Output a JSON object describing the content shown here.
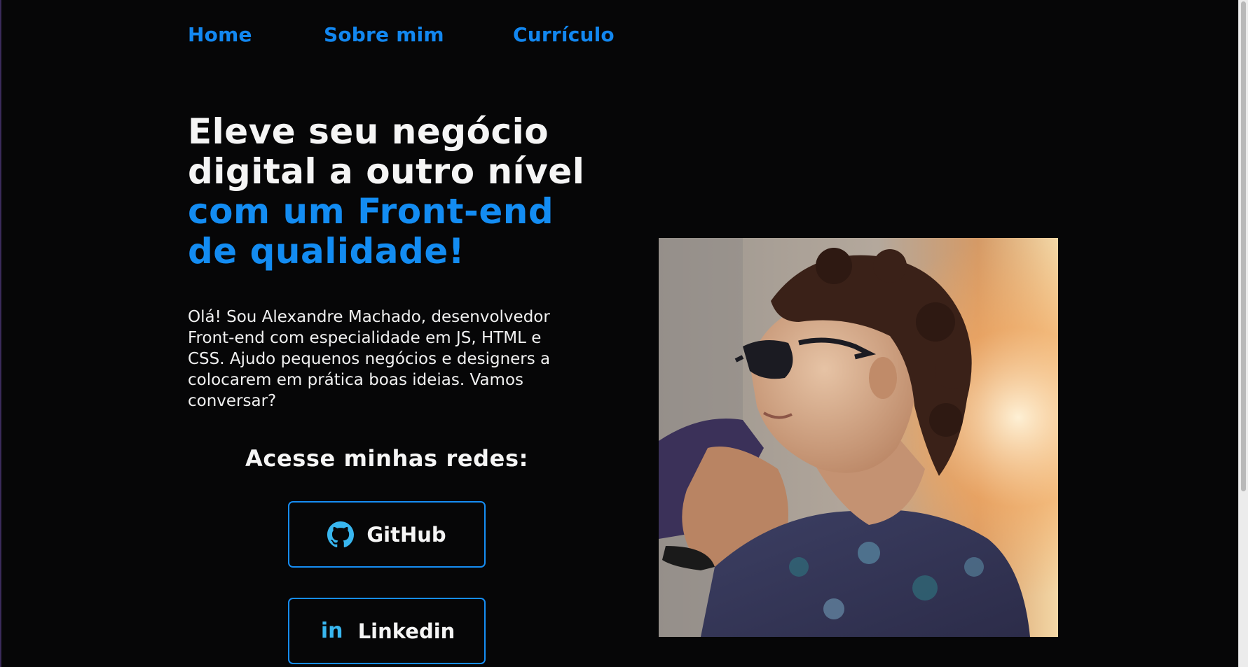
{
  "nav": {
    "items": [
      {
        "label": "Home"
      },
      {
        "label": "Sobre mim"
      },
      {
        "label": "Currículo"
      }
    ]
  },
  "hero": {
    "title_white": [
      "Eleve seu negócio",
      "digital a outro nível"
    ],
    "title_blue": [
      "com um Front-end",
      "de qualidade!"
    ]
  },
  "intro": {
    "lines": [
      "Olá! Sou Alexandre Machado, desenvolvedor",
      "Front-end com especialidade em JS, HTML e",
      "CSS. Ajudo pequenos negócios e designers a",
      "colocarem em prática boas ideias. Vamos",
      "conversar?"
    ]
  },
  "social": {
    "heading": "Acesse minhas redes:",
    "github": {
      "label": "GitHub",
      "icon": "github-icon"
    },
    "linkedin": {
      "label": "Linkedin",
      "icon": "linkedin-icon",
      "glyph": "in"
    }
  },
  "colors": {
    "background": "#060607",
    "accent": "#138cf2",
    "icon": "#38b6ef",
    "text": "#f5f5f5"
  }
}
